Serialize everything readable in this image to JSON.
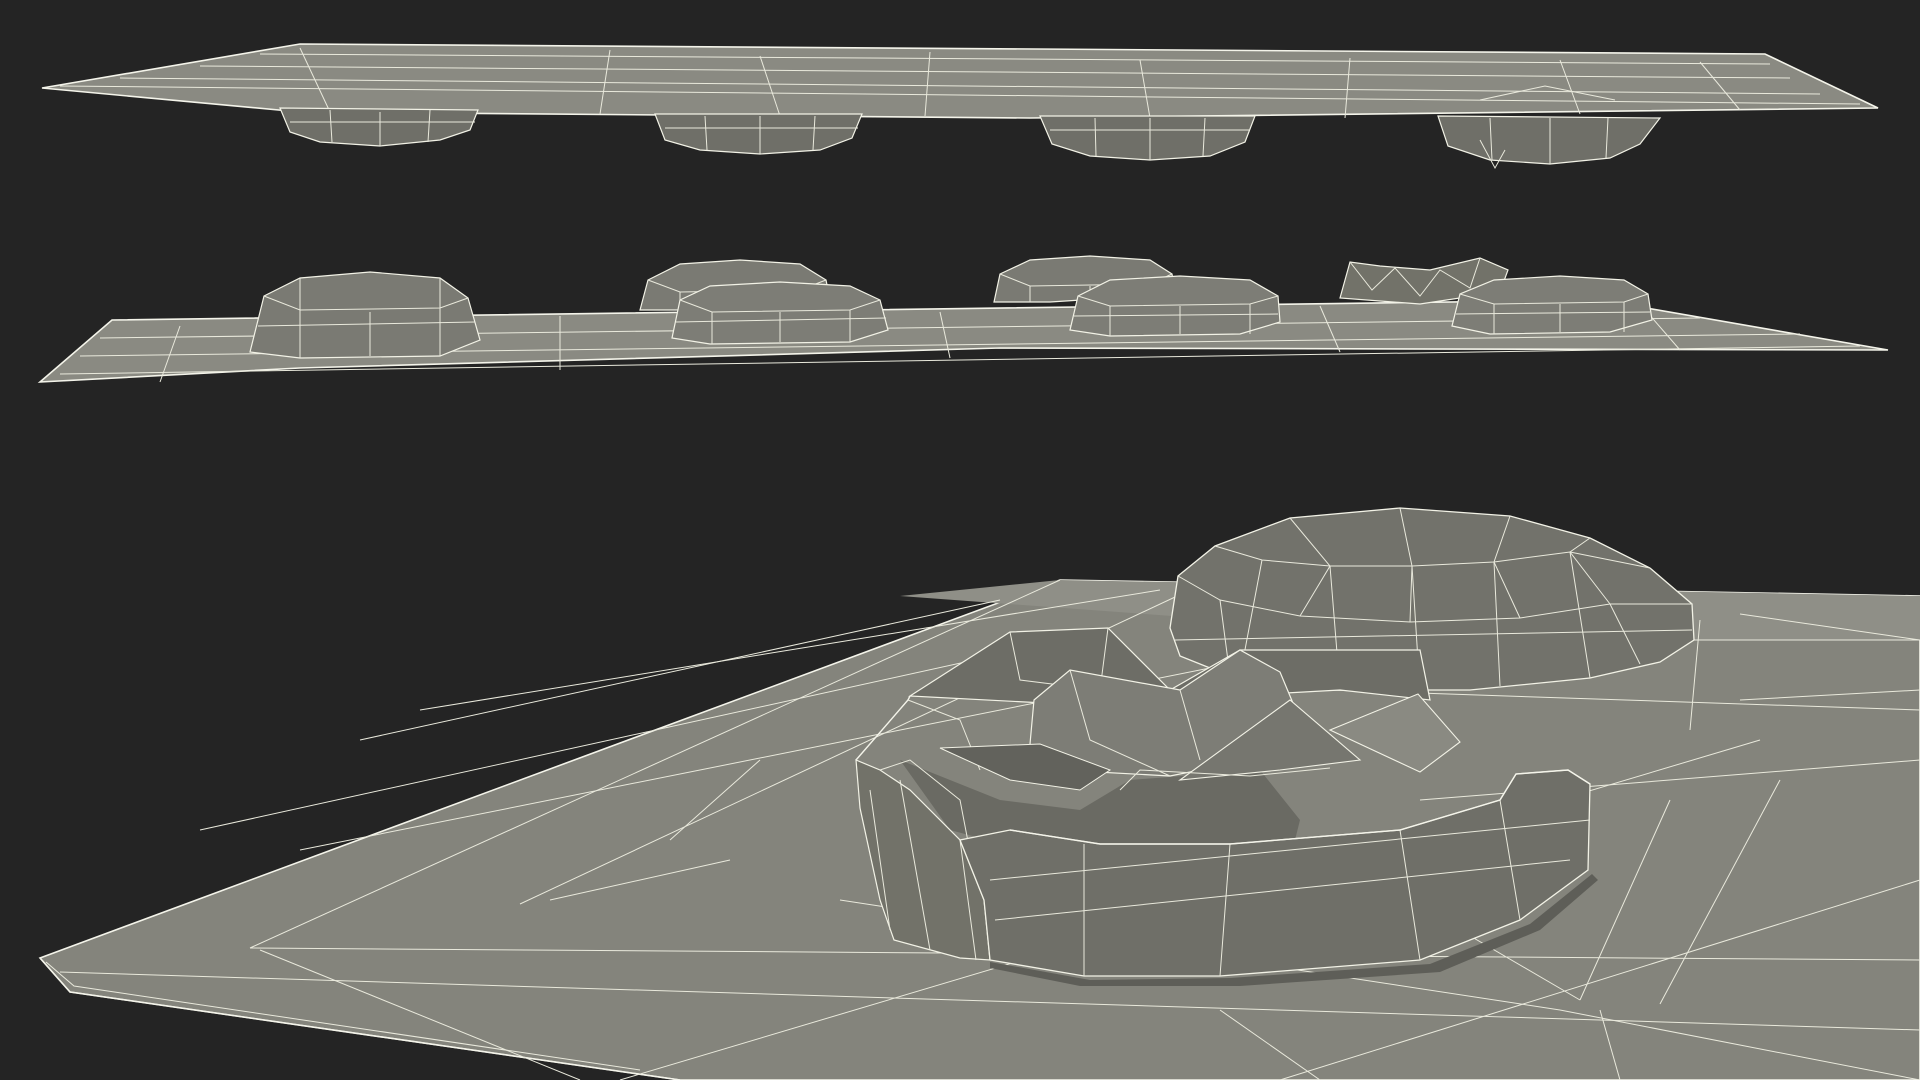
{
  "scene": {
    "background_color": "#242424",
    "surface_color": "#808078",
    "surface_light_color": "#8c8c84",
    "surface_dark_color": "#5e5e58",
    "wire_color": "#f2f2e6",
    "blister_cavities_per_row": 4,
    "views": [
      {
        "name": "top-view-underside",
        "description_visible": ""
      },
      {
        "name": "top-view-overside",
        "description_visible": ""
      },
      {
        "name": "closeup-view",
        "description_visible": ""
      }
    ]
  }
}
